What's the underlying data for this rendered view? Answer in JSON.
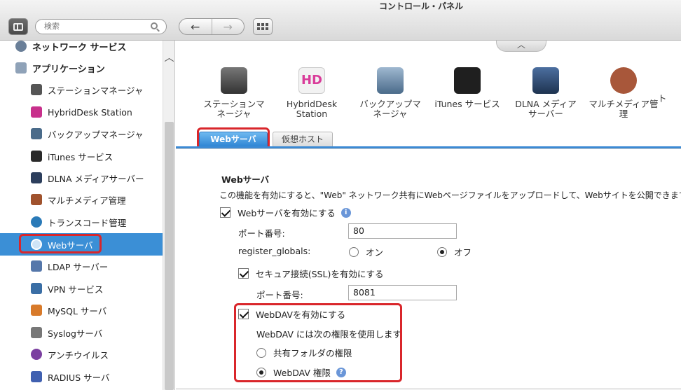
{
  "window": {
    "title": "コントロール・パネル"
  },
  "toolbar": {
    "search_placeholder": "検索",
    "back": "←",
    "forward": "→"
  },
  "sidebar": {
    "network": "ネットワーク サービス",
    "applications": "アプリケーション",
    "items": [
      {
        "label": "ステーションマネージャ",
        "color": "#555555"
      },
      {
        "label": "HybridDesk Station",
        "color": "#c8308c"
      },
      {
        "label": "バックアップマネージャ",
        "color": "#4a6b8a"
      },
      {
        "label": "iTunes サービス",
        "color": "#2a2a2a"
      },
      {
        "label": "DLNA メディアサーバー",
        "color": "#2c3e5c"
      },
      {
        "label": "マルチメディア管理",
        "color": "#a0522d"
      },
      {
        "label": "トランスコード管理",
        "color": "#2a7ab8"
      },
      {
        "label": "Webサーバ",
        "color": "#2f7ac8"
      },
      {
        "label": "LDAP サーバー",
        "color": "#5577aa"
      },
      {
        "label": "VPN サービス",
        "color": "#3a6ea5"
      },
      {
        "label": "MySQL サーバ",
        "color": "#d87a2a"
      },
      {
        "label": "Syslogサーバ",
        "color": "#777777"
      },
      {
        "label": "アンチウイルス",
        "color": "#7b3fa0"
      },
      {
        "label": "RADIUS サーバ",
        "color": "#4060b0"
      }
    ]
  },
  "apps": [
    {
      "line1": "ステーションマ",
      "line2": "ネージャ",
      "color": "#3c3c3c"
    },
    {
      "line1": "HybridDesk",
      "line2": "Station",
      "color": "#d93c9a"
    },
    {
      "line1": "バックアップマ",
      "line2": "ネージャ",
      "color": "#5a7da0"
    },
    {
      "line1": "iTunes サービス",
      "line2": "",
      "color": "#1f1f1f"
    },
    {
      "line1": "DLNA メディア",
      "line2": "サーバー",
      "color": "#1e3350"
    },
    {
      "line1": "マルチメディア管",
      "line2": "理",
      "color": "#a8573a"
    },
    {
      "line1": "ト",
      "line2": "",
      "color": "#888888"
    }
  ],
  "tabs": {
    "web_server": "Webサーバ",
    "virtual_host": "仮想ホスト"
  },
  "web": {
    "section_title": "Webサーバ",
    "description": "この機能を有効にすると、\"Web\" ネットワーク共有にWebページファイルをアップロードして、Webサイトを公開できます。",
    "enable_label": "Webサーバを有効にする",
    "port_label": "ポート番号:",
    "port_value": "80",
    "register_globals_label": "register_globals:",
    "on_label": "オン",
    "off_label": "オフ",
    "ssl_label": "セキュア接続(SSL)を有効にする",
    "ssl_port_label": "ポート番号:",
    "ssl_port_value": "8081",
    "webdav_label": "WebDAVを有効にする",
    "webdav_desc": "WebDAV には次の権限を使用します",
    "perm_share": "共有フォルダの権限",
    "perm_webdav": "WebDAV 権限"
  }
}
